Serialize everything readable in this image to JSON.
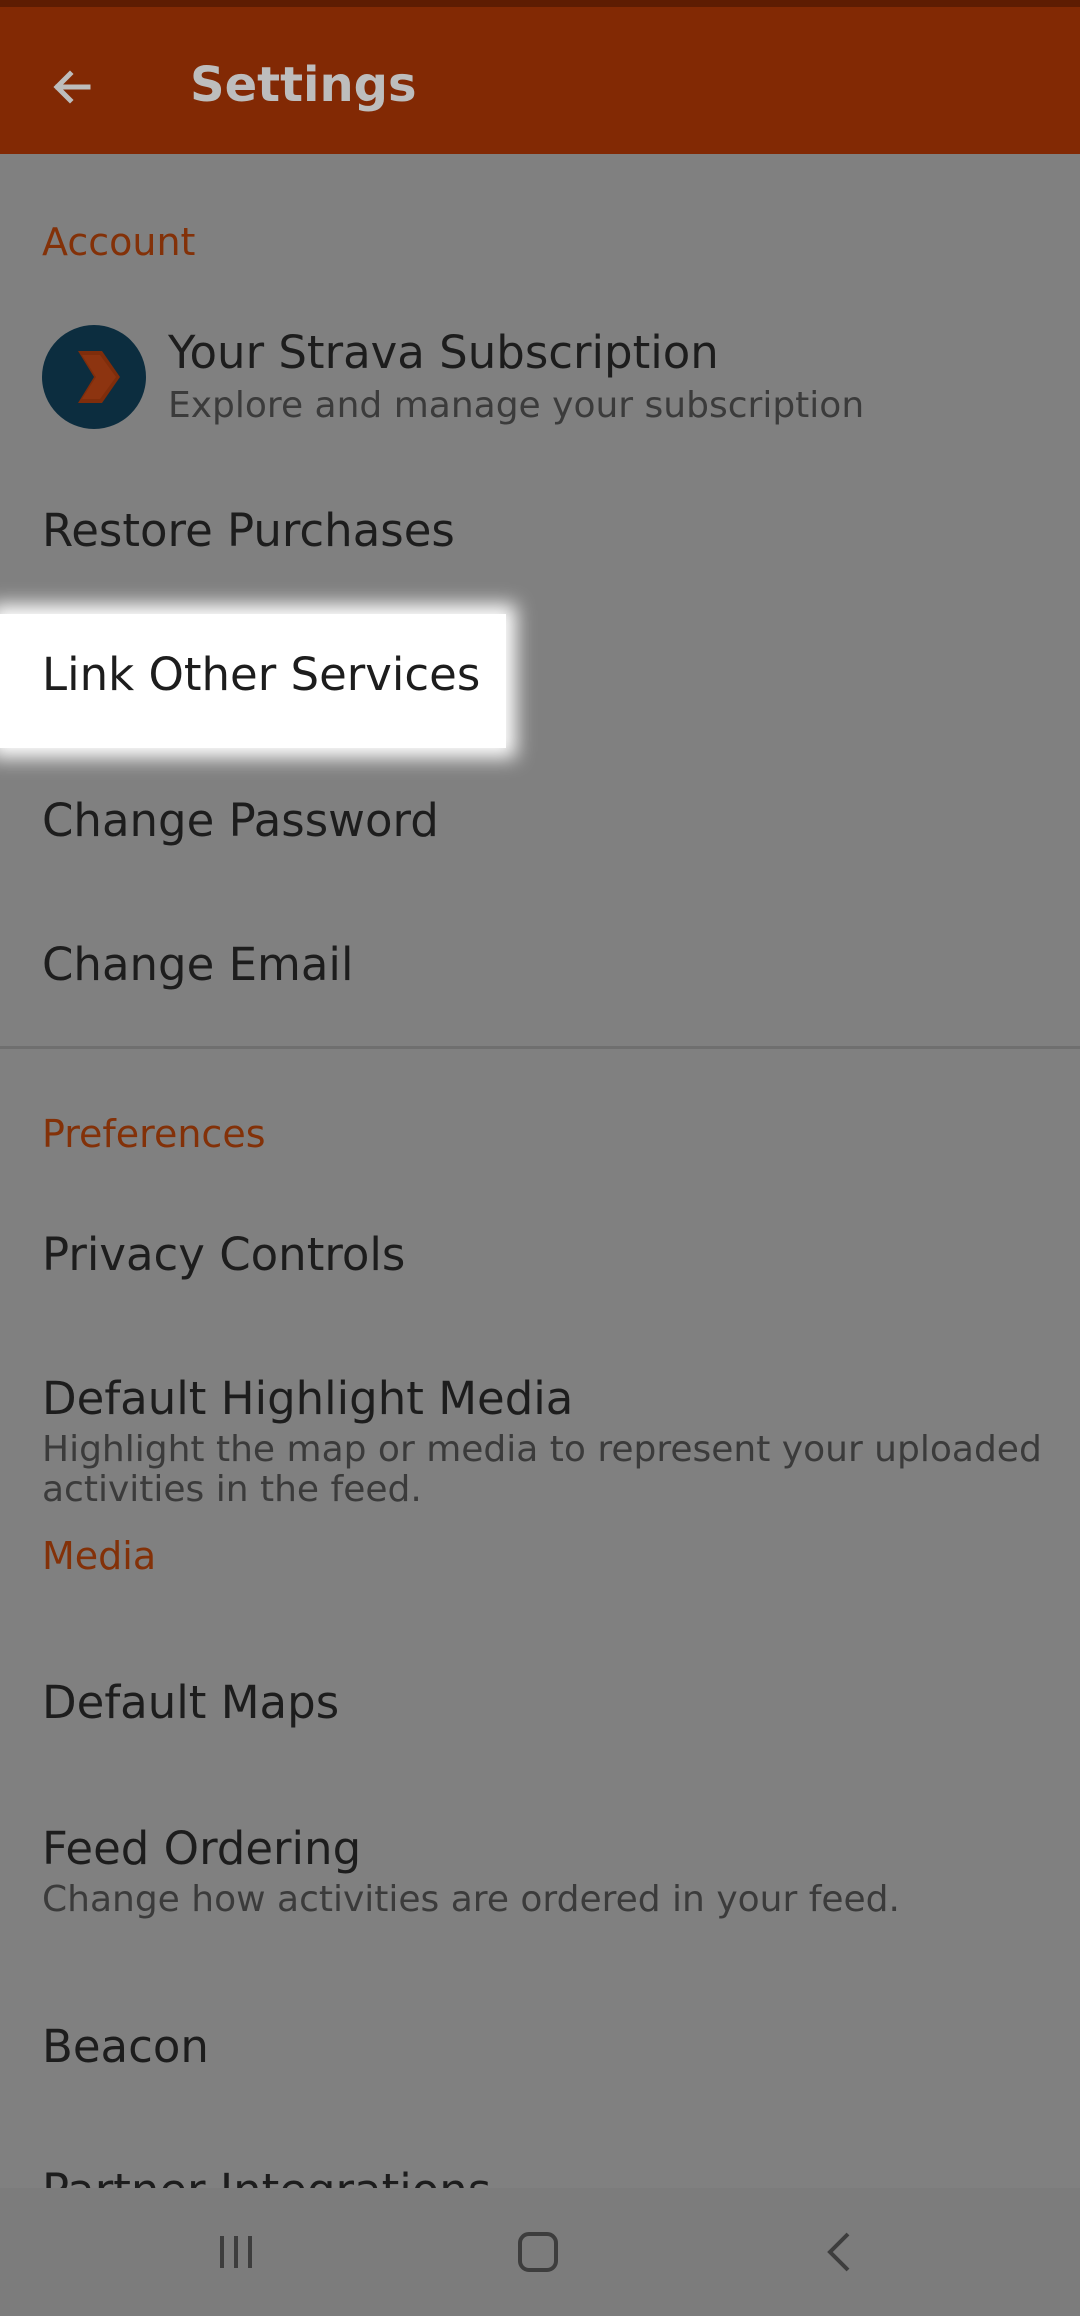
{
  "app_bar": {
    "title": "Settings",
    "back_icon": "arrow-left-icon"
  },
  "account": {
    "header": "Account",
    "subscription": {
      "title": "Your Strava Subscription",
      "subtitle": "Explore and manage your subscription",
      "icon": "strava-chevron-icon"
    },
    "items": [
      {
        "label": "Restore Purchases"
      },
      {
        "label": "Link Other Services"
      },
      {
        "label": "Change Password"
      },
      {
        "label": "Change Email"
      }
    ]
  },
  "preferences": {
    "header": "Preferences",
    "privacy": {
      "label": "Privacy Controls"
    },
    "highlight_media": {
      "title": "Default Highlight Media",
      "subtitle": "Highlight the map or media to represent your uploaded activities in the feed.",
      "value": "Media"
    },
    "default_maps": {
      "label": "Default Maps"
    },
    "feed_ordering": {
      "title": "Feed Ordering",
      "subtitle": "Change how activities are ordered in your feed."
    },
    "beacon": {
      "label": "Beacon"
    },
    "partner": {
      "label": "Partner Integrations"
    }
  },
  "nav": {
    "recents_icon": "recents-icon",
    "home_icon": "home-icon",
    "back_icon": "back-icon"
  },
  "colors": {
    "app_bar": "#822904",
    "section_header": "#833108",
    "overlay": "#808080",
    "highlight": "#ffffff"
  }
}
